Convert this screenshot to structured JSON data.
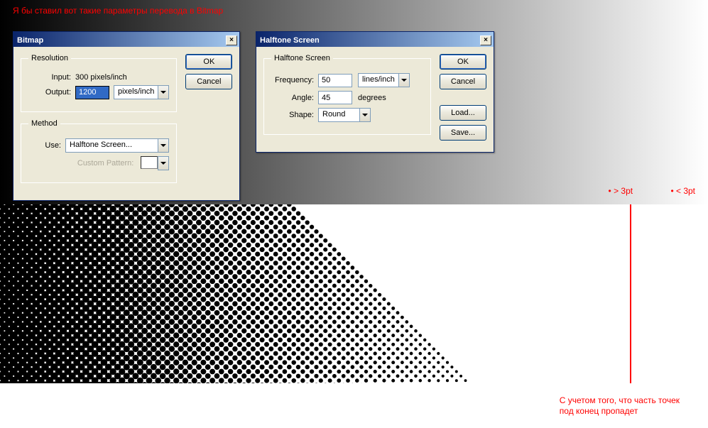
{
  "captions": {
    "top": "Я бы ставил вот такие параметры перевода в Bitmap",
    "bottom_line1": "С учетом того, что часть точек",
    "bottom_line2": "под конец пропадет"
  },
  "markers": {
    "left": "• > 3pt",
    "right": "• < 3pt"
  },
  "bitmap_dialog": {
    "title": "Bitmap",
    "groups": {
      "resolution": "Resolution",
      "method": "Method"
    },
    "labels": {
      "input": "Input:",
      "output": "Output:",
      "use": "Use:",
      "custom_pattern": "Custom Pattern:"
    },
    "values": {
      "input_value": "300 pixels/inch",
      "output_value": "1200",
      "output_unit": "pixels/inch",
      "use_value": "Halftone Screen..."
    },
    "buttons": {
      "ok": "OK",
      "cancel": "Cancel"
    }
  },
  "halftone_dialog": {
    "title": "Halftone Screen",
    "group": "Halftone Screen",
    "labels": {
      "frequency": "Frequency:",
      "angle": "Angle:",
      "shape": "Shape:"
    },
    "values": {
      "frequency_value": "50",
      "frequency_unit": "lines/inch",
      "angle_value": "45",
      "angle_unit": "degrees",
      "shape_value": "Round"
    },
    "buttons": {
      "ok": "OK",
      "cancel": "Cancel",
      "load": "Load...",
      "save": "Save..."
    }
  },
  "colors": {
    "annotation": "#ff0000",
    "redline": "#ff0000"
  }
}
